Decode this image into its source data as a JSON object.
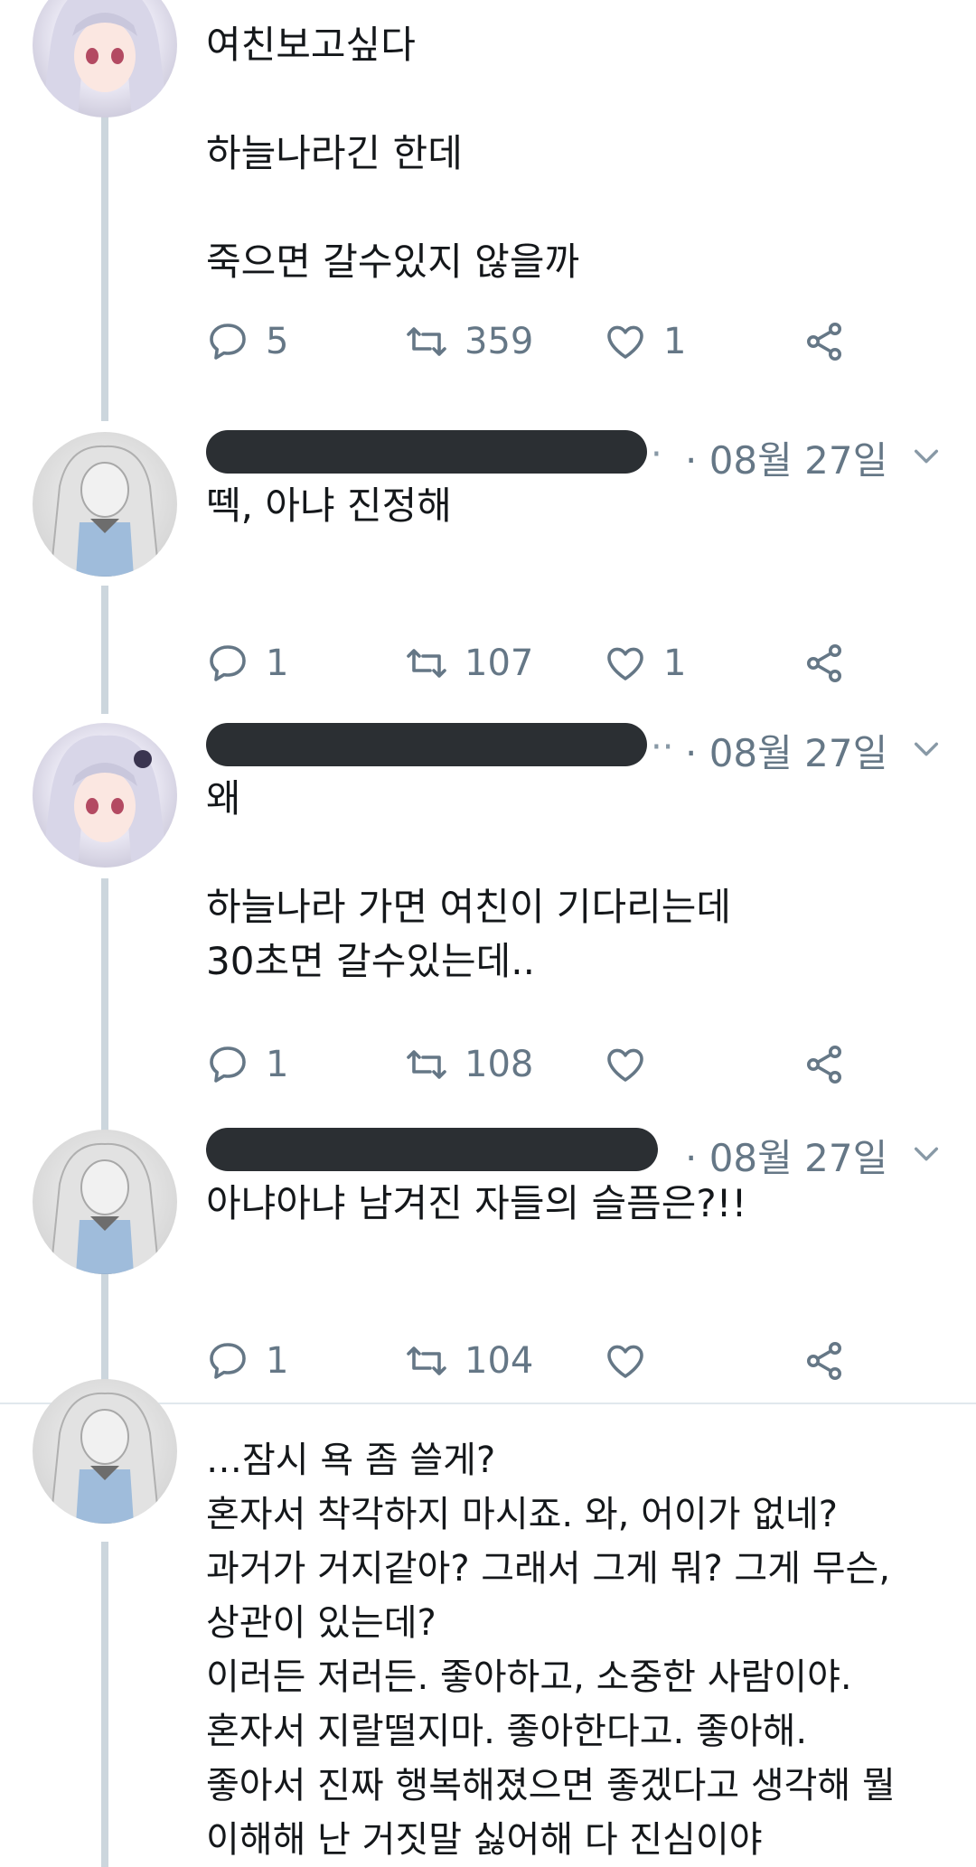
{
  "tweets": [
    {
      "text": "여친보고싶다\n\n하늘나라긴 한데\n\n죽으면 갈수있지 않을까",
      "replies": "5",
      "retweets": "359",
      "likes": "1"
    },
    {
      "date": "· 08월 27일",
      "text": "떽, 아냐 진정해",
      "replies": "1",
      "retweets": "107",
      "likes": "1"
    },
    {
      "date": "· 08월 27일",
      "text": "왜\n\n하늘나라 가면 여친이 기다리는데\n30초면 갈수있는데..",
      "replies": "1",
      "retweets": "108",
      "likes": ""
    },
    {
      "date": "· 08월 27일",
      "text": "아냐아냐 남겨진 자들의 슬픔은?!!",
      "replies": "1",
      "retweets": "104",
      "likes": ""
    },
    {
      "text": "…잠시 욕 좀 쓸게?\n혼자서 착각하지 마시죠. 와, 어이가 없네?\n과거가 거지같아? 그래서 그게 뭐? 그게 무슨,\n상관이 있는데?\n이러든 저러든. 좋아하고, 소중한 사람이야.\n혼자서 지랄떨지마. 좋아한다고. 좋아해.\n좋아서 진짜 행복해졌으면 좋겠다고 생각해 뭘\n이해해 난 거짓말 싫어해 다 진심이야"
    }
  ],
  "icons": [
    "reply-icon",
    "retweet-icon",
    "like-icon",
    "share-icon",
    "chevron-down-icon"
  ],
  "colors": {
    "thread_line": "#ccd6dd",
    "muted_text": "#657786",
    "redaction": "#2b2f33"
  }
}
